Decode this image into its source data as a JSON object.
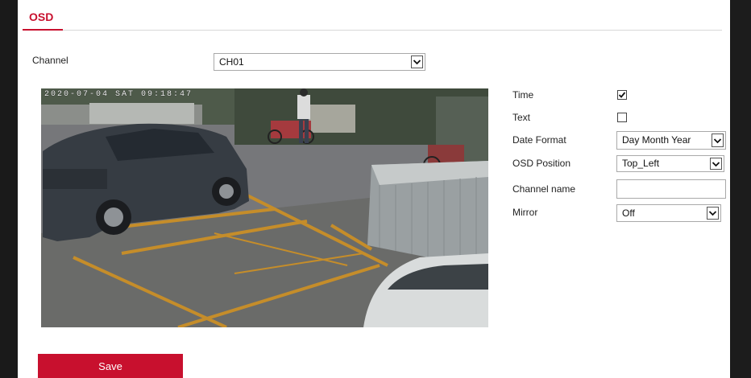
{
  "tabs": [
    {
      "label": "OSD",
      "active": true
    }
  ],
  "channel": {
    "label": "Channel",
    "value": "CH01"
  },
  "preview": {
    "osd_timestamp": "2020-07-04 SAT 09:18:47"
  },
  "settings": {
    "time": {
      "label": "Time",
      "checked": true
    },
    "text": {
      "label": "Text",
      "checked": false
    },
    "date_format": {
      "label": "Date Format",
      "value": "Day Month Year"
    },
    "osd_position": {
      "label": "OSD Position",
      "value": "Top_Left"
    },
    "channel_name": {
      "label": "Channel name",
      "value": ""
    },
    "mirror": {
      "label": "Mirror",
      "value": "Off"
    }
  },
  "save_label": "Save",
  "colors": {
    "accent": "#c8102e",
    "frame": "#1a1a1a",
    "background": "#ffffff"
  },
  "icons": [
    "chevron-down-icon",
    "checkmark-icon"
  ]
}
